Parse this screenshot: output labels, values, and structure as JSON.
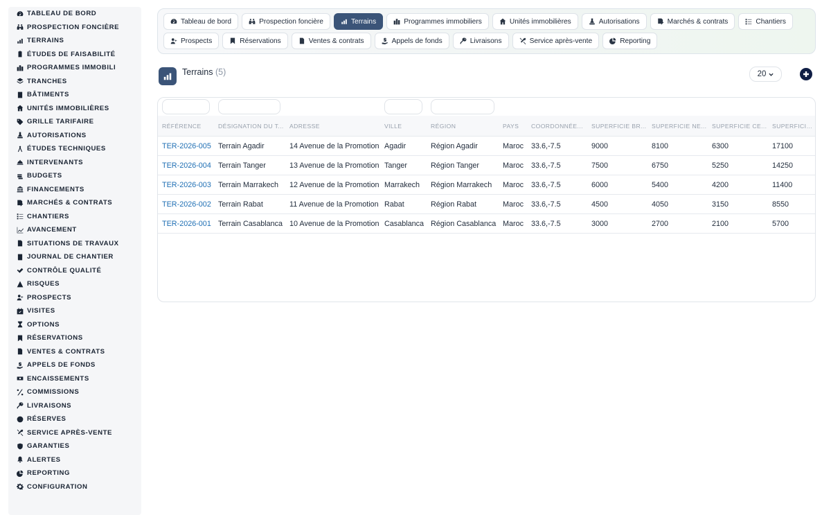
{
  "sidebar": {
    "items": [
      {
        "label": "Tableau de bord",
        "icon": "gauge-icon"
      },
      {
        "label": "Prospection foncière",
        "icon": "binoculars-icon"
      },
      {
        "label": "Terrains",
        "icon": "map-pins-icon"
      },
      {
        "label": "Études de faisabilité",
        "icon": "clipboard-check-icon"
      },
      {
        "label": "Programmes immobili",
        "icon": "city-icon"
      },
      {
        "label": "Tranches",
        "icon": "layers-icon"
      },
      {
        "label": "Bâtiments",
        "icon": "building-icon"
      },
      {
        "label": "Unités immobilières",
        "icon": "house-icon"
      },
      {
        "label": "Grille tarifaire",
        "icon": "tags-icon"
      },
      {
        "label": "Autorisations",
        "icon": "stamp-icon"
      },
      {
        "label": "Études techniques",
        "icon": "compass-drafting-icon"
      },
      {
        "label": "Intervenants",
        "icon": "helmet-icon"
      },
      {
        "label": "Budgets",
        "icon": "coins-icon"
      },
      {
        "label": "Financements",
        "icon": "bank-icon"
      },
      {
        "label": "Marchés & contrats",
        "icon": "file-signature-icon"
      },
      {
        "label": "Chantiers",
        "icon": "list-check-icon"
      },
      {
        "label": "Avancement",
        "icon": "chart-line-icon"
      },
      {
        "label": "Situations de travaux",
        "icon": "file-invoice-icon"
      },
      {
        "label": "Journal de chantier",
        "icon": "book-icon"
      },
      {
        "label": "Contrôle qualité",
        "icon": "check-double-icon"
      },
      {
        "label": "Risques",
        "icon": "warning-icon"
      },
      {
        "label": "Prospects",
        "icon": "user-plus-icon"
      },
      {
        "label": "Visites",
        "icon": "calendar-check-icon"
      },
      {
        "label": "Options",
        "icon": "hourglass-icon"
      },
      {
        "label": "Réservations",
        "icon": "bookmark-icon"
      },
      {
        "label": "Ventes & contrats",
        "icon": "file-contract-icon"
      },
      {
        "label": "Appels de fonds",
        "icon": "hand-holding-dollar-icon"
      },
      {
        "label": "Encaissements",
        "icon": "money-bill-icon"
      },
      {
        "label": "Commissions",
        "icon": "percent-icon"
      },
      {
        "label": "Livraisons",
        "icon": "key-icon"
      },
      {
        "label": "Réserves",
        "icon": "exclamation-circle-icon"
      },
      {
        "label": "Service après-vente",
        "icon": "tools-icon"
      },
      {
        "label": "Garanties",
        "icon": "shield-icon"
      },
      {
        "label": "Alertes",
        "icon": "bell-icon"
      },
      {
        "label": "Reporting",
        "icon": "pie-chart-icon"
      },
      {
        "label": "Configuration",
        "icon": "gear-icon"
      }
    ]
  },
  "tabs": {
    "row1": [
      {
        "label": "Tableau de bord",
        "icon": "gauge-icon",
        "active": false
      },
      {
        "label": "Prospection foncière",
        "icon": "binoculars-icon",
        "active": false
      },
      {
        "label": "Terrains",
        "icon": "map-pins-icon",
        "active": true
      },
      {
        "label": "Programmes immobiliers",
        "icon": "city-icon",
        "active": false
      },
      {
        "label": "Unités immobilières",
        "icon": "house-icon",
        "active": false
      },
      {
        "label": "Autorisations",
        "icon": "stamp-icon",
        "active": false
      },
      {
        "label": "Marchés & contrats",
        "icon": "file-signature-icon",
        "active": false
      },
      {
        "label": "Chantiers",
        "icon": "list-check-icon",
        "active": false
      }
    ],
    "row2": [
      {
        "label": "Prospects",
        "icon": "user-plus-icon",
        "active": false
      },
      {
        "label": "Réservations",
        "icon": "bookmark-icon",
        "active": false
      },
      {
        "label": "Ventes & contrats",
        "icon": "file-contract-icon",
        "active": false
      },
      {
        "label": "Appels de fonds",
        "icon": "hand-holding-dollar-icon",
        "active": false
      },
      {
        "label": "Livraisons",
        "icon": "key-icon",
        "active": false
      },
      {
        "label": "Service après-vente",
        "icon": "tools-icon",
        "active": false
      },
      {
        "label": "Reporting",
        "icon": "pie-chart-icon",
        "active": false
      }
    ]
  },
  "page": {
    "title": "Terrains",
    "count": "(5)",
    "title_icon": "map-pins-icon",
    "page_size": "20",
    "add_icon": "plus-circle-icon"
  },
  "table": {
    "columns": [
      "Référence",
      "Désignation du t...",
      "Adresse",
      "Ville",
      "Région",
      "Pays",
      "Coordonnée...",
      "Superficie br...",
      "Superficie ne...",
      "Superficie ce...",
      "Superficie c"
    ],
    "rows": [
      [
        "TER-2026-005",
        "Terrain Agadir",
        "14 Avenue de la Promotion",
        "Agadir",
        "Région Agadir",
        "Maroc",
        "33.6,-7.5",
        "9000",
        "8100",
        "6300",
        "17100"
      ],
      [
        "TER-2026-004",
        "Terrain Tanger",
        "13 Avenue de la Promotion",
        "Tanger",
        "Région Tanger",
        "Maroc",
        "33.6,-7.5",
        "7500",
        "6750",
        "5250",
        "14250"
      ],
      [
        "TER-2026-003",
        "Terrain Marrakech",
        "12 Avenue de la Promotion",
        "Marrakech",
        "Région Marrakech",
        "Maroc",
        "33.6,-7.5",
        "6000",
        "5400",
        "4200",
        "11400"
      ],
      [
        "TER-2026-002",
        "Terrain Rabat",
        "11 Avenue de la Promotion",
        "Rabat",
        "Région Rabat",
        "Maroc",
        "33.6,-7.5",
        "4500",
        "4050",
        "3150",
        "8550"
      ],
      [
        "TER-2026-001",
        "Terrain Casablanca",
        "10 Avenue de la Promotion",
        "Casablanca",
        "Région Casablanca",
        "Maroc",
        "33.6,-7.5",
        "3000",
        "2700",
        "2100",
        "5700"
      ]
    ]
  },
  "colors": {
    "active_tab": "#3b5478",
    "link": "#1f6fb4",
    "add_button": "#0f1e45"
  }
}
